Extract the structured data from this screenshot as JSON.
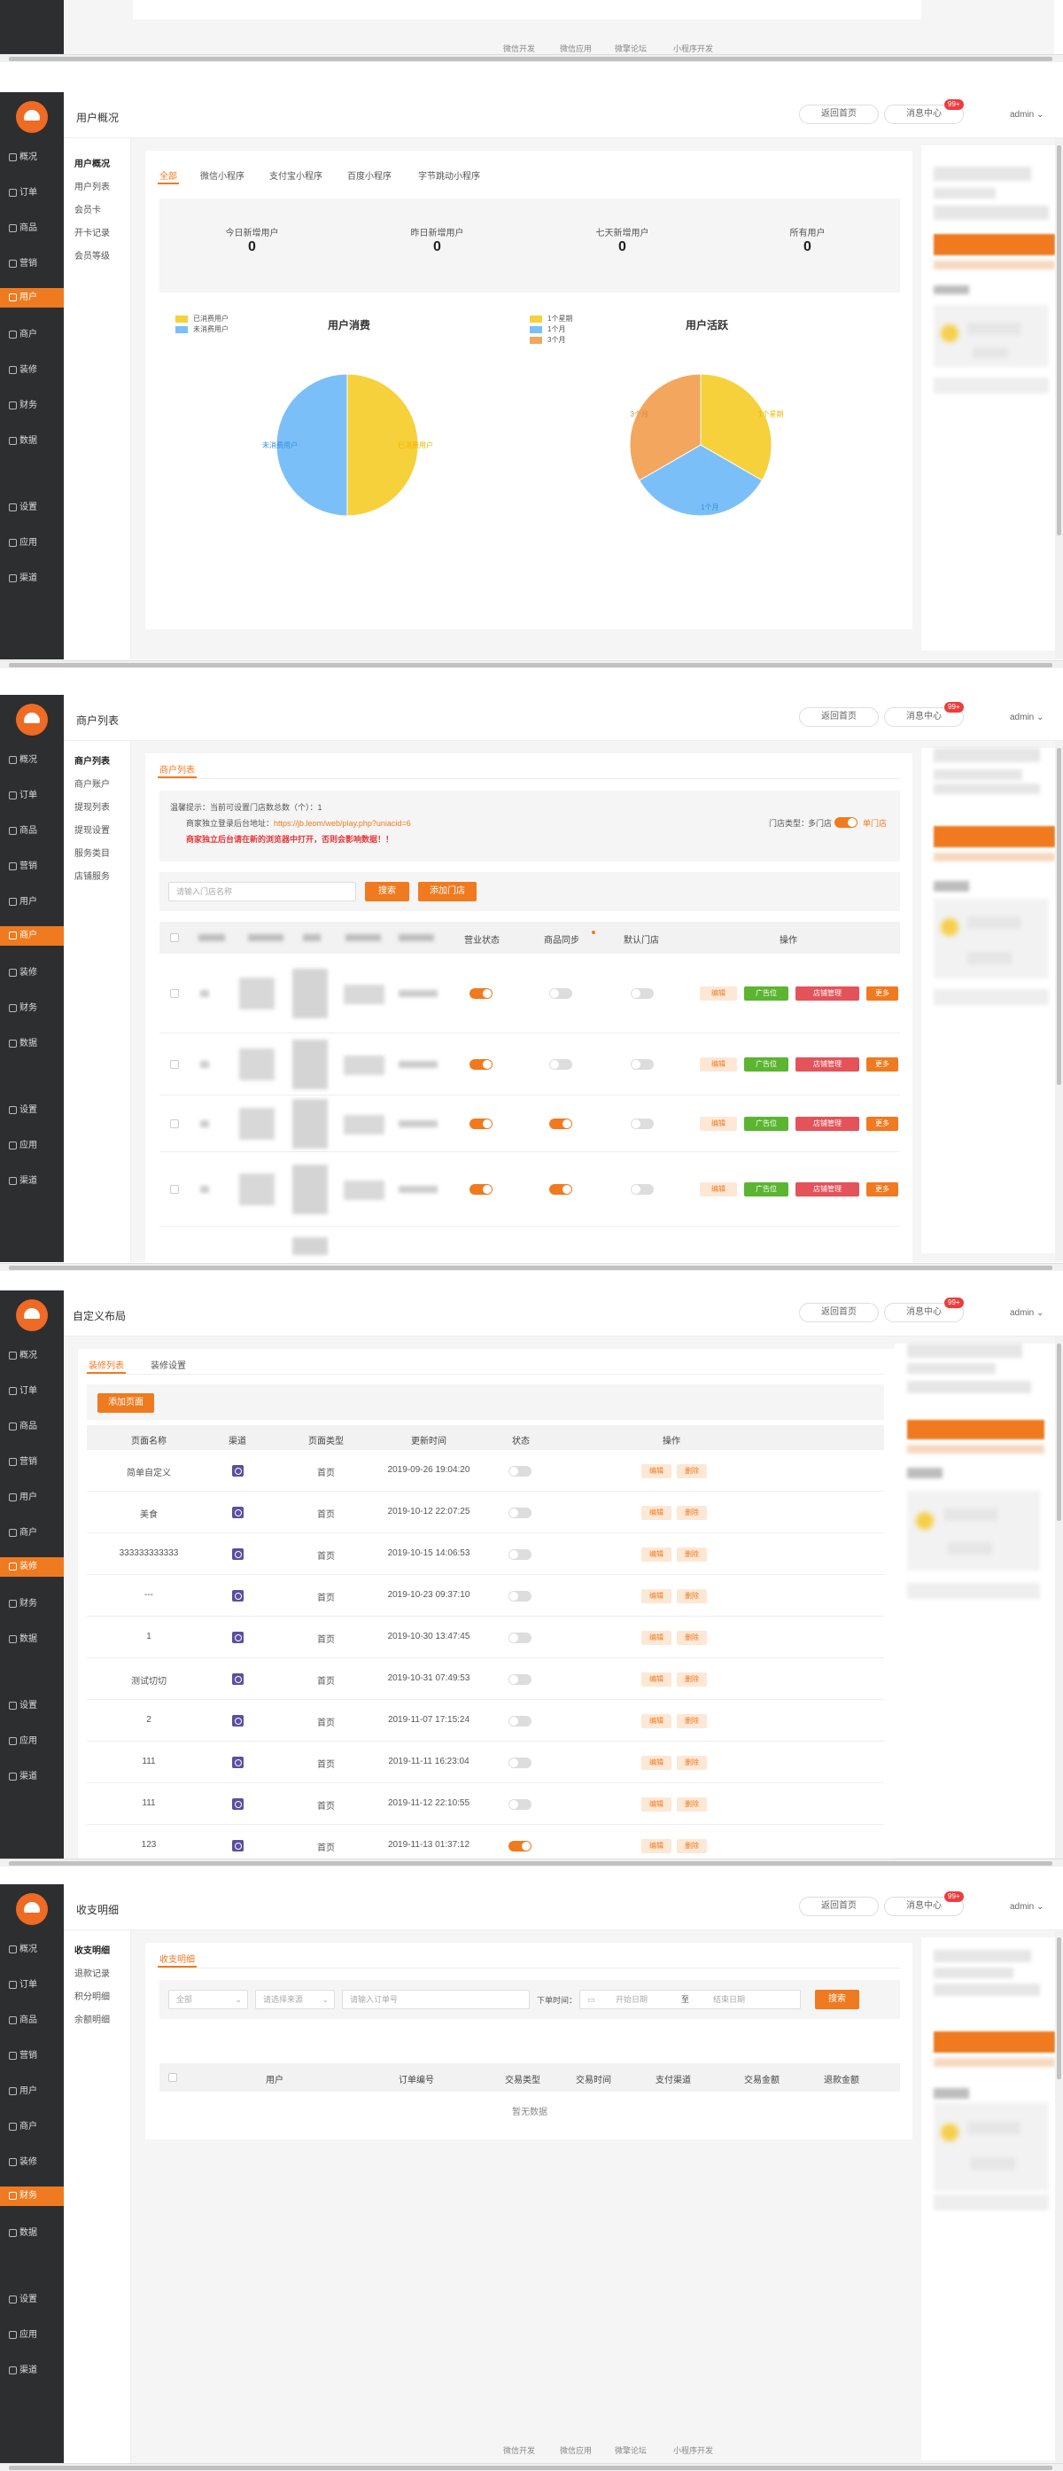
{
  "topbar": {
    "back_home": "返回首页",
    "msg_center": "消息中心",
    "msg_badge": "99+",
    "admin": "admin"
  },
  "footer_links": [
    "微信开发",
    "微信应用",
    "微擎论坛",
    "小程序开发"
  ],
  "nav_items": [
    "概况",
    "订单",
    "商品",
    "营销",
    "用户",
    "商户",
    "装修",
    "财务",
    "数据",
    "设置",
    "应用",
    "渠道"
  ],
  "user_overview": {
    "title": "用户概况",
    "sub_items": [
      "用户概况",
      "用户列表",
      "会员卡",
      "开卡记录",
      "会员等级"
    ],
    "tabs": [
      "全部",
      "微信小程序",
      "支付宝小程序",
      "百度小程序",
      "字节跳动小程序"
    ],
    "stats": [
      {
        "label": "今日新增用户",
        "value": "0"
      },
      {
        "label": "昨日新增用户",
        "value": "0"
      },
      {
        "label": "七天新增用户",
        "value": "0"
      },
      {
        "label": "所有用户",
        "value": "0"
      }
    ],
    "chart_consumption": {
      "title": "用户消费",
      "legend": [
        "已消费用户",
        "未消费用户"
      ],
      "slice_labels": [
        "已消费用户",
        "未消费用户"
      ]
    },
    "chart_activity": {
      "title": "用户活跃",
      "legend": [
        "1个星期",
        "1个月",
        "3个月"
      ],
      "slice_labels": [
        "1个星期",
        "1个月",
        "3个月"
      ]
    }
  },
  "chart_data": [
    {
      "type": "pie",
      "title": "用户消费",
      "labels": [
        "已消费用户",
        "未消费用户"
      ],
      "values": [
        50,
        50
      ],
      "colors": [
        "#f6d13b",
        "#7bbff8"
      ]
    },
    {
      "type": "pie",
      "title": "用户活跃",
      "labels": [
        "1个星期",
        "1个月",
        "3个月"
      ],
      "values": [
        33.3,
        33.3,
        33.3
      ],
      "colors": [
        "#f6d13b",
        "#7bbff8",
        "#f2a65e"
      ]
    }
  ],
  "merchant_list": {
    "title": "商户列表",
    "sub_items": [
      "商户列表",
      "商户账户",
      "提现列表",
      "提现设置",
      "服务类目",
      "店铺服务"
    ],
    "tab": "商户列表",
    "notice_line1": "温馨提示：当前可设置门店数总数（个）：1",
    "notice_line2_prefix": "商家独立登录后台地址：",
    "notice_line2_link": "https://jb.leom/web/play.php?uniacid=6",
    "notice_line3": "商家独立后台请在新的浏览器中打开，否则会影响数据！！",
    "mode_label": "门店类型：",
    "mode_left": "多门店",
    "mode_right": "单门店",
    "search_placeholder": "请输入门店名称",
    "search_btn": "搜索",
    "add_btn": "添加门店",
    "columns": [
      "营业状态",
      "商品同步",
      "默认门店",
      "操作"
    ],
    "row_actions": [
      "编辑",
      "广告位",
      "店铺管理",
      "更多"
    ],
    "rows": [
      {
        "business": true,
        "sync": false,
        "default": false
      },
      {
        "business": true,
        "sync": false,
        "default": false
      },
      {
        "business": true,
        "sync": true,
        "default": false
      },
      {
        "business": true,
        "sync": true,
        "default": false
      }
    ]
  },
  "custom_layout": {
    "title": "自定义布局",
    "tabs": [
      "装修列表",
      "装修设置"
    ],
    "add_btn": "添加页面",
    "columns": [
      "页面名称",
      "渠道",
      "页面类型",
      "更新时间",
      "状态",
      "操作"
    ],
    "row_actions": [
      "编辑",
      "删除"
    ],
    "rows": [
      {
        "name": "简单自定义",
        "type": "首页",
        "time": "2019-09-26 19:04:20",
        "on": false
      },
      {
        "name": "美食",
        "type": "首页",
        "time": "2019-10-12 22:07:25",
        "on": false
      },
      {
        "name": "333333333333",
        "type": "首页",
        "time": "2019-10-15 14:06:53",
        "on": false
      },
      {
        "name": "---",
        "type": "首页",
        "time": "2019-10-23 09:37:10",
        "on": false
      },
      {
        "name": "1",
        "type": "首页",
        "time": "2019-10-30 13:47:45",
        "on": false
      },
      {
        "name": "测试切切",
        "type": "首页",
        "time": "2019-10-31 07:49:53",
        "on": false
      },
      {
        "name": "2",
        "type": "首页",
        "time": "2019-11-07 17:15:24",
        "on": false
      },
      {
        "name": "111",
        "type": "首页",
        "time": "2019-11-11 16:23:04",
        "on": false
      },
      {
        "name": "111",
        "type": "首页",
        "time": "2019-11-12 22:10:55",
        "on": false
      },
      {
        "name": "123",
        "type": "首页",
        "time": "2019-11-13 01:37:12",
        "on": true
      }
    ]
  },
  "income_detail": {
    "title": "收支明细",
    "sub_items": [
      "收支明细",
      "退款记录",
      "积分明细",
      "余额明细"
    ],
    "tab": "收支明细",
    "select1": "全部",
    "select2": "请选择来源",
    "order_placeholder": "请输入订单号",
    "date_label": "下单时间：",
    "date_start": "开始日期",
    "date_sep": "至",
    "date_end": "结束日期",
    "search_btn": "搜索",
    "columns": [
      "用户",
      "订单编号",
      "交易类型",
      "交易时间",
      "支付渠道",
      "交易金额",
      "退款金额"
    ],
    "empty": "暂无数据"
  }
}
